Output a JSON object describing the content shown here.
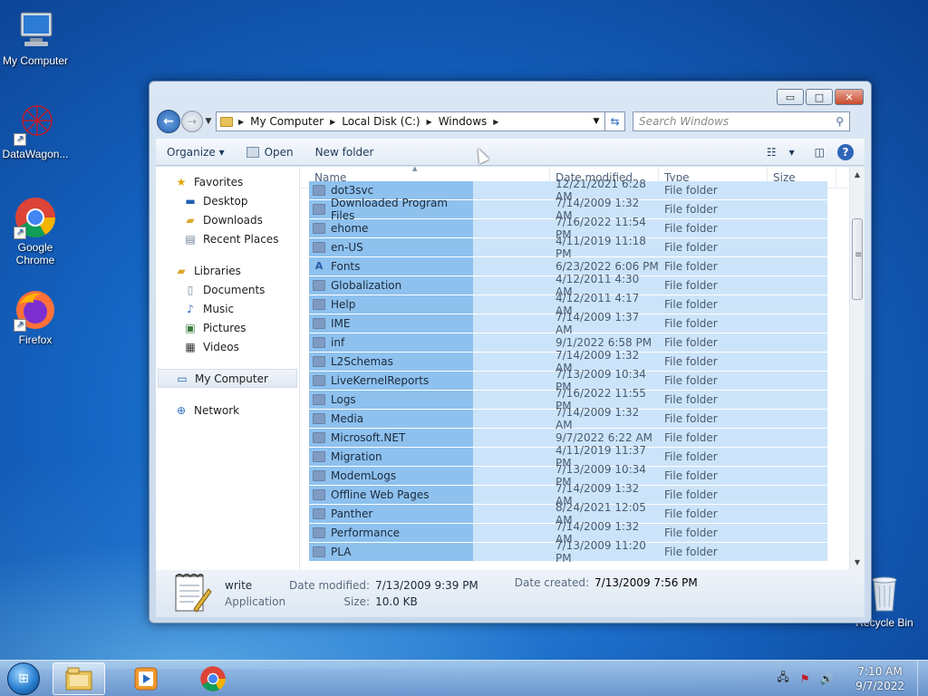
{
  "desktop": {
    "icons": [
      {
        "label": "My Computer",
        "icon": "computer-icon"
      },
      {
        "label": "DataWagon...",
        "icon": "datawagon-icon"
      },
      {
        "label": "Google Chrome",
        "icon": "chrome-icon"
      },
      {
        "label": "Firefox",
        "icon": "firefox-icon"
      },
      {
        "label": "Recycle Bin",
        "icon": "recycle-bin-icon"
      }
    ]
  },
  "window": {
    "controls": {
      "minimize": "▭",
      "maximize": "□",
      "close": "✕"
    },
    "address": {
      "crumbs": [
        "My Computer",
        "Local Disk (C:)",
        "Windows"
      ]
    },
    "search": {
      "placeholder": "Search Windows"
    },
    "toolbar": {
      "organize": "Organize ▾",
      "open": "Open",
      "new_folder": "New folder",
      "view_dropdown": "▾"
    },
    "nav": {
      "favorites": "Favorites",
      "desktop": "Desktop",
      "downloads": "Downloads",
      "recent_places": "Recent Places",
      "libraries": "Libraries",
      "documents": "Documents",
      "music": "Music",
      "pictures": "Pictures",
      "videos": "Videos",
      "my_computer": "My Computer",
      "network": "Network"
    },
    "columns": {
      "name": "Name",
      "date": "Date modified",
      "type": "Type",
      "size": "Size"
    },
    "files": [
      {
        "name": "dot3svc",
        "date": "12/21/2021 6:28 AM",
        "type": "File folder",
        "size": ""
      },
      {
        "name": "Downloaded Program Files",
        "date": "7/14/2009 1:32 AM",
        "type": "File folder",
        "size": ""
      },
      {
        "name": "ehome",
        "date": "7/16/2022 11:54 PM",
        "type": "File folder",
        "size": ""
      },
      {
        "name": "en-US",
        "date": "4/11/2019 11:18 PM",
        "type": "File folder",
        "size": ""
      },
      {
        "name": "Fonts",
        "date": "6/23/2022 6:06 PM",
        "type": "File folder",
        "size": ""
      },
      {
        "name": "Globalization",
        "date": "4/12/2011 4:30 AM",
        "type": "File folder",
        "size": ""
      },
      {
        "name": "Help",
        "date": "4/12/2011 4:17 AM",
        "type": "File folder",
        "size": ""
      },
      {
        "name": "IME",
        "date": "7/14/2009 1:37 AM",
        "type": "File folder",
        "size": ""
      },
      {
        "name": "inf",
        "date": "9/1/2022 6:58 PM",
        "type": "File folder",
        "size": ""
      },
      {
        "name": "L2Schemas",
        "date": "7/14/2009 1:32 AM",
        "type": "File folder",
        "size": ""
      },
      {
        "name": "LiveKernelReports",
        "date": "7/13/2009 10:34 PM",
        "type": "File folder",
        "size": ""
      },
      {
        "name": "Logs",
        "date": "7/16/2022 11:55 PM",
        "type": "File folder",
        "size": ""
      },
      {
        "name": "Media",
        "date": "7/14/2009 1:32 AM",
        "type": "File folder",
        "size": ""
      },
      {
        "name": "Microsoft.NET",
        "date": "9/7/2022 6:22 AM",
        "type": "File folder",
        "size": ""
      },
      {
        "name": "Migration",
        "date": "4/11/2019 11:37 PM",
        "type": "File folder",
        "size": ""
      },
      {
        "name": "ModemLogs",
        "date": "7/13/2009 10:34 PM",
        "type": "File folder",
        "size": ""
      },
      {
        "name": "Offline Web Pages",
        "date": "7/14/2009 1:32 AM",
        "type": "File folder",
        "size": ""
      },
      {
        "name": "Panther",
        "date": "8/24/2021 12:05 AM",
        "type": "File folder",
        "size": ""
      },
      {
        "name": "Performance",
        "date": "7/14/2009 1:32 AM",
        "type": "File folder",
        "size": ""
      },
      {
        "name": "PLA",
        "date": "7/13/2009 11:20 PM",
        "type": "File folder",
        "size": ""
      }
    ],
    "details": {
      "name": "write",
      "type": "Application",
      "date_modified_label": "Date modified:",
      "date_modified": "7/13/2009 9:39 PM",
      "size_label": "Size:",
      "size": "10.0 KB",
      "date_created_label": "Date created:",
      "date_created": "7/13/2009 7:56 PM"
    }
  },
  "taskbar": {
    "clock_time": "7:10 AM",
    "clock_date": "9/7/2022"
  }
}
